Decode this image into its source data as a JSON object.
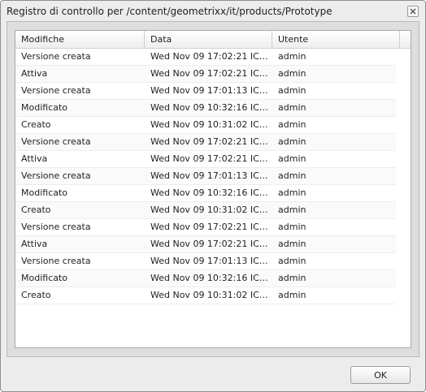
{
  "dialog": {
    "title": "Registro di controllo per /content/geometrixx/it/products/Prototype",
    "ok_label": "OK"
  },
  "table": {
    "columns": [
      "Modifiche",
      "Data",
      "Utente",
      ""
    ],
    "rows": [
      [
        "Versione creata",
        "Wed Nov 09 17:02:21 ICT 2...",
        "admin"
      ],
      [
        "Attiva",
        "Wed Nov 09 17:02:21 ICT 2...",
        "admin"
      ],
      [
        "Versione creata",
        "Wed Nov 09 17:01:13 ICT 2...",
        "admin"
      ],
      [
        "Modificato",
        "Wed Nov 09 10:32:16 ICT 2...",
        "admin"
      ],
      [
        "Creato",
        "Wed Nov 09 10:31:02 ICT 2...",
        "admin"
      ],
      [
        "Versione creata",
        "Wed Nov 09 17:02:21 ICT 2...",
        "admin"
      ],
      [
        "Attiva",
        "Wed Nov 09 17:02:21 ICT 2...",
        "admin"
      ],
      [
        "Versione creata",
        "Wed Nov 09 17:01:13 ICT 2...",
        "admin"
      ],
      [
        "Modificato",
        "Wed Nov 09 10:32:16 ICT 2...",
        "admin"
      ],
      [
        "Creato",
        "Wed Nov 09 10:31:02 ICT 2...",
        "admin"
      ],
      [
        "Versione creata",
        "Wed Nov 09 17:02:21 ICT 2...",
        "admin"
      ],
      [
        "Attiva",
        "Wed Nov 09 17:02:21 ICT 2...",
        "admin"
      ],
      [
        "Versione creata",
        "Wed Nov 09 17:01:13 ICT 2...",
        "admin"
      ],
      [
        "Modificato",
        "Wed Nov 09 10:32:16 ICT 2...",
        "admin"
      ],
      [
        "Creato",
        "Wed Nov 09 10:31:02 ICT 2...",
        "admin"
      ]
    ]
  }
}
